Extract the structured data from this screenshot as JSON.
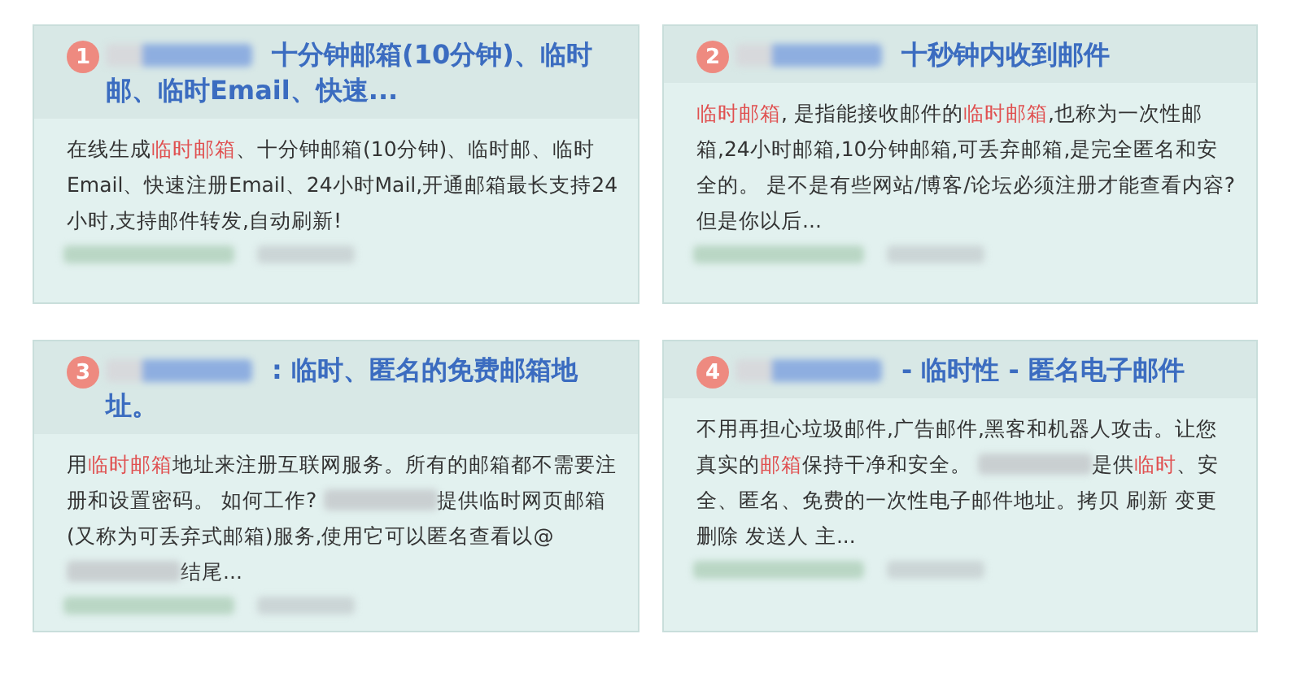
{
  "results": [
    {
      "number": "1",
      "title": "十分钟邮箱(10分钟)、临时邮、临时Email、快速...",
      "snippet": [
        {
          "kind": "text",
          "text": "在线生成"
        },
        {
          "kind": "highlight",
          "text": "临时邮箱"
        },
        {
          "kind": "text",
          "text": "、十分钟邮箱(10分钟)、临时邮、临时Email、快速注册Email、24小时Mail,开通邮箱最长支持24小时,支持邮件转发,自动刷新!"
        }
      ]
    },
    {
      "number": "2",
      "title": "十秒钟内收到邮件",
      "snippet": [
        {
          "kind": "highlight",
          "text": "临时邮箱"
        },
        {
          "kind": "text",
          "text": ", 是指能接收邮件的"
        },
        {
          "kind": "highlight",
          "text": "临时邮箱"
        },
        {
          "kind": "text",
          "text": ",也称为一次性邮箱,24小时邮箱,10分钟邮箱,可丢弃邮箱,是完全匿名和安全的。 是不是有些网站/博客/论坛必须注册才能查看内容?但是你以后..."
        }
      ]
    },
    {
      "number": "3",
      "title": ": 临时、匿名的免费邮箱地址。",
      "snippet": [
        {
          "kind": "text",
          "text": "用"
        },
        {
          "kind": "highlight",
          "text": "临时邮箱"
        },
        {
          "kind": "text",
          "text": "地址来注册互联网服务。所有的邮箱都不需要注册和设置密码。 如何工作? "
        },
        {
          "kind": "blur"
        },
        {
          "kind": "text",
          "text": "提供临时网页邮箱(又称为可丢弃式邮箱)服务,使用它可以匿名查看以@"
        },
        {
          "kind": "blur"
        },
        {
          "kind": "text",
          "text": "结尾..."
        }
      ]
    },
    {
      "number": "4",
      "title": "- 临时性 - 匿名电子邮件",
      "snippet": [
        {
          "kind": "text",
          "text": "不用再担心垃圾邮件,广告邮件,黑客和机器人攻击。让您真实的"
        },
        {
          "kind": "highlight",
          "text": "邮箱"
        },
        {
          "kind": "text",
          "text": "保持干净和安全。 "
        },
        {
          "kind": "blur"
        },
        {
          "kind": "text",
          "text": "是供"
        },
        {
          "kind": "highlight",
          "text": "临时"
        },
        {
          "kind": "text",
          "text": "、安全、匿名、免费的一次性电子邮件地址。拷贝 刷新 变更删除 发送人 主..."
        }
      ]
    }
  ]
}
